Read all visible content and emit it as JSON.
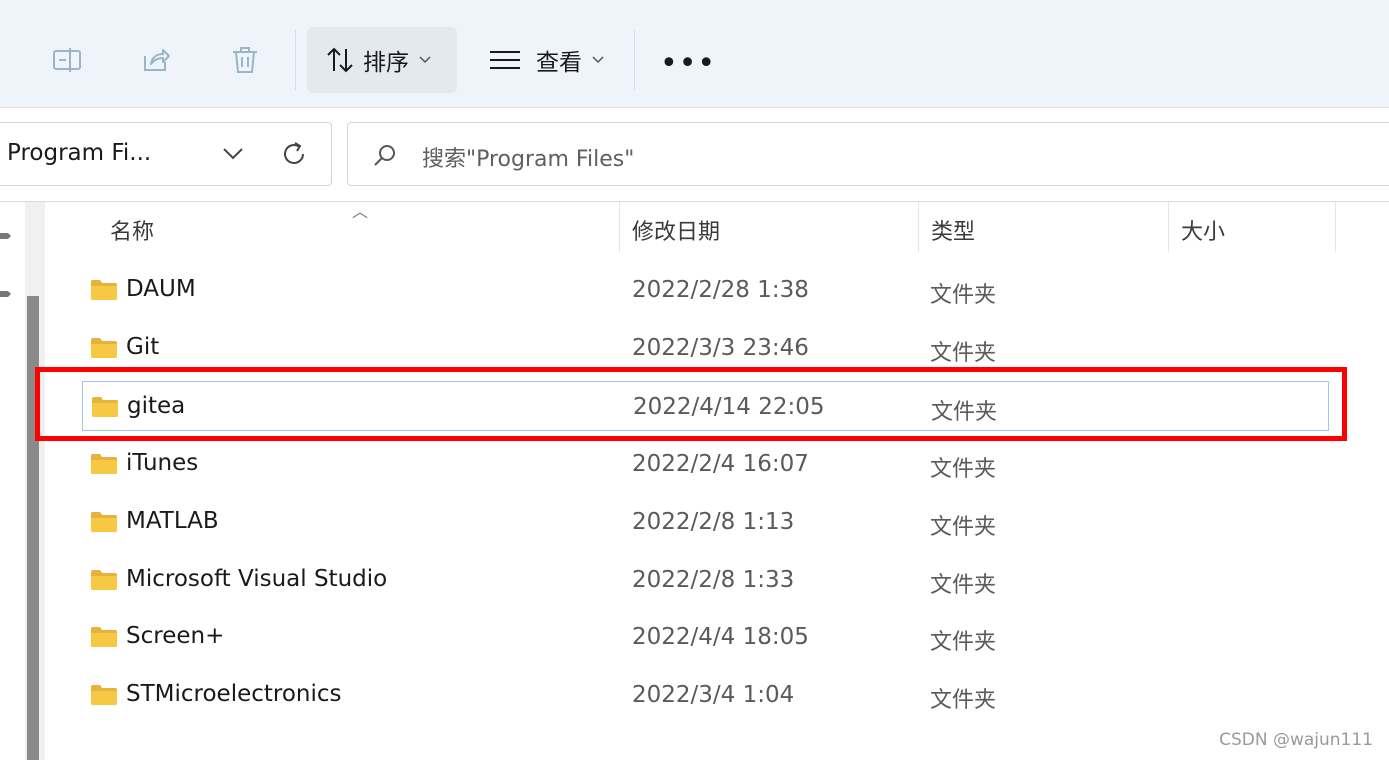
{
  "toolbar": {
    "rename_icon": "rename-icon",
    "share_icon": "share-icon",
    "delete_icon": "trash-icon",
    "sort_label": "排序",
    "view_label": "查看",
    "more_label": "•••"
  },
  "address": {
    "path_text": "Program Fi...",
    "search_placeholder": "搜索\"Program Files\""
  },
  "columns": {
    "name": "名称",
    "modified": "修改日期",
    "type": "类型",
    "size": "大小"
  },
  "files": [
    {
      "name": "DAUM",
      "modified": "2022/2/28 1:38",
      "type": "文件夹",
      "selected": false
    },
    {
      "name": "Git",
      "modified": "2022/3/3 23:46",
      "type": "文件夹",
      "selected": false
    },
    {
      "name": "gitea",
      "modified": "2022/4/14 22:05",
      "type": "文件夹",
      "selected": true
    },
    {
      "name": "iTunes",
      "modified": "2022/2/4 16:07",
      "type": "文件夹",
      "selected": false
    },
    {
      "name": "MATLAB",
      "modified": "2022/2/8 1:13",
      "type": "文件夹",
      "selected": false
    },
    {
      "name": "Microsoft Visual Studio",
      "modified": "2022/2/8 1:33",
      "type": "文件夹",
      "selected": false
    },
    {
      "name": "Screen+",
      "modified": "2022/4/4 18:05",
      "type": "文件夹",
      "selected": false
    },
    {
      "name": "STMicroelectronics",
      "modified": "2022/3/4 1:04",
      "type": "文件夹",
      "selected": false
    }
  ],
  "watermark": "CSDN @wajun111",
  "colors": {
    "highlight": "#ff0000",
    "folder": "#f6c844",
    "selection_border": "#9fc5e8"
  }
}
